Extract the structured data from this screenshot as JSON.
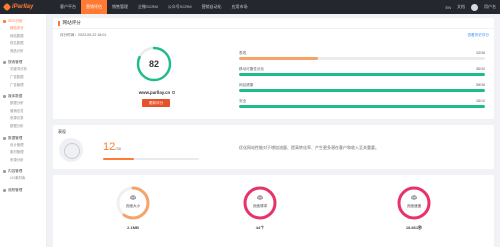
{
  "logo": "iParllay",
  "nav": [
    {
      "label": "客户平台",
      "active": false
    },
    {
      "label": "营销评估",
      "active": true
    },
    {
      "label": "销售管理",
      "active": false
    },
    {
      "label": "企微SCRM",
      "active": false
    },
    {
      "label": "公众号SCRM",
      "active": false
    },
    {
      "label": "营销自动化",
      "active": false
    },
    {
      "label": "应用市场",
      "active": false
    }
  ],
  "header_right": {
    "lang": "EN",
    "extra": "文档",
    "username": "用户名"
  },
  "sidebar": [
    {
      "label": "SEO分析",
      "active": true,
      "items": [
        {
          "label": "网站评分",
          "active": true
        },
        {
          "label": "网站数据",
          "active": false
        },
        {
          "label": "排名数据",
          "active": false
        },
        {
          "label": "竞品分析",
          "active": false
        }
      ]
    },
    {
      "label": "搜索管理",
      "active": false,
      "items": [
        {
          "label": "关键词分析",
          "active": false
        },
        {
          "label": "广告数据",
          "active": false
        },
        {
          "label": "广告管理",
          "active": false
        }
      ]
    },
    {
      "label": "媒体数据",
      "active": false,
      "items": [
        {
          "label": "数据分析",
          "active": false
        },
        {
          "label": "营销总览",
          "active": false
        },
        {
          "label": "来源记录",
          "active": false
        },
        {
          "label": "数据分析",
          "active": false
        }
      ]
    },
    {
      "label": "数据管理",
      "active": false,
      "items": [
        {
          "label": "设计管理",
          "active": false
        },
        {
          "label": "素材管理",
          "active": false
        },
        {
          "label": "来源分析",
          "active": false
        }
      ]
    },
    {
      "label": "内容管理",
      "active": false,
      "items": [
        {
          "label": "UG素材库",
          "active": false
        }
      ]
    },
    {
      "label": "追踪管理",
      "active": false,
      "items": []
    }
  ],
  "card1": {
    "title": "网站评分",
    "eval_time": "评分时间：2023-09-22 18:01",
    "history_link": "查看历史评分",
    "score": "82",
    "score_fraction": 0.82,
    "domain": "www.parllay.cn",
    "update_button": "更新评分",
    "metrics": [
      {
        "label": "表现",
        "score": "12",
        "max": "/38",
        "fraction": 0.32,
        "color": "#f6a36b"
      },
      {
        "label": "移动可靠性优化",
        "score": "30",
        "max": "/30",
        "fraction": 1.0,
        "color": "#1ebc8c"
      },
      {
        "label": "网站健康",
        "score": "39",
        "max": "/38",
        "fraction": 1.0,
        "color": "#1ebc8c"
      },
      {
        "label": "安全",
        "score": "10",
        "max": "/10",
        "fraction": 1.0,
        "color": "#1ebc8c"
      }
    ]
  },
  "card2": {
    "label": "表现",
    "score": "12",
    "max": "/38",
    "fraction": 0.32,
    "description": "优化网站性能对于增加流量、提高转化率、产生更多潜在客户和收入至关重要。"
  },
  "card3": {
    "items": [
      {
        "label": "页面大小",
        "value": "2.1MB",
        "color": "#f6a36b",
        "fraction": 0.6
      },
      {
        "label": "页面请求",
        "value": "44个",
        "color": "#e8336a",
        "fraction": 1.0
      },
      {
        "label": "页面速度",
        "value": "18.861秒",
        "color": "#e8336a",
        "fraction": 1.0
      }
    ]
  },
  "colors": {
    "accent": "#ff7a33",
    "success": "#1ebc8c",
    "danger": "#e8336a",
    "topbar": "#24272e"
  }
}
